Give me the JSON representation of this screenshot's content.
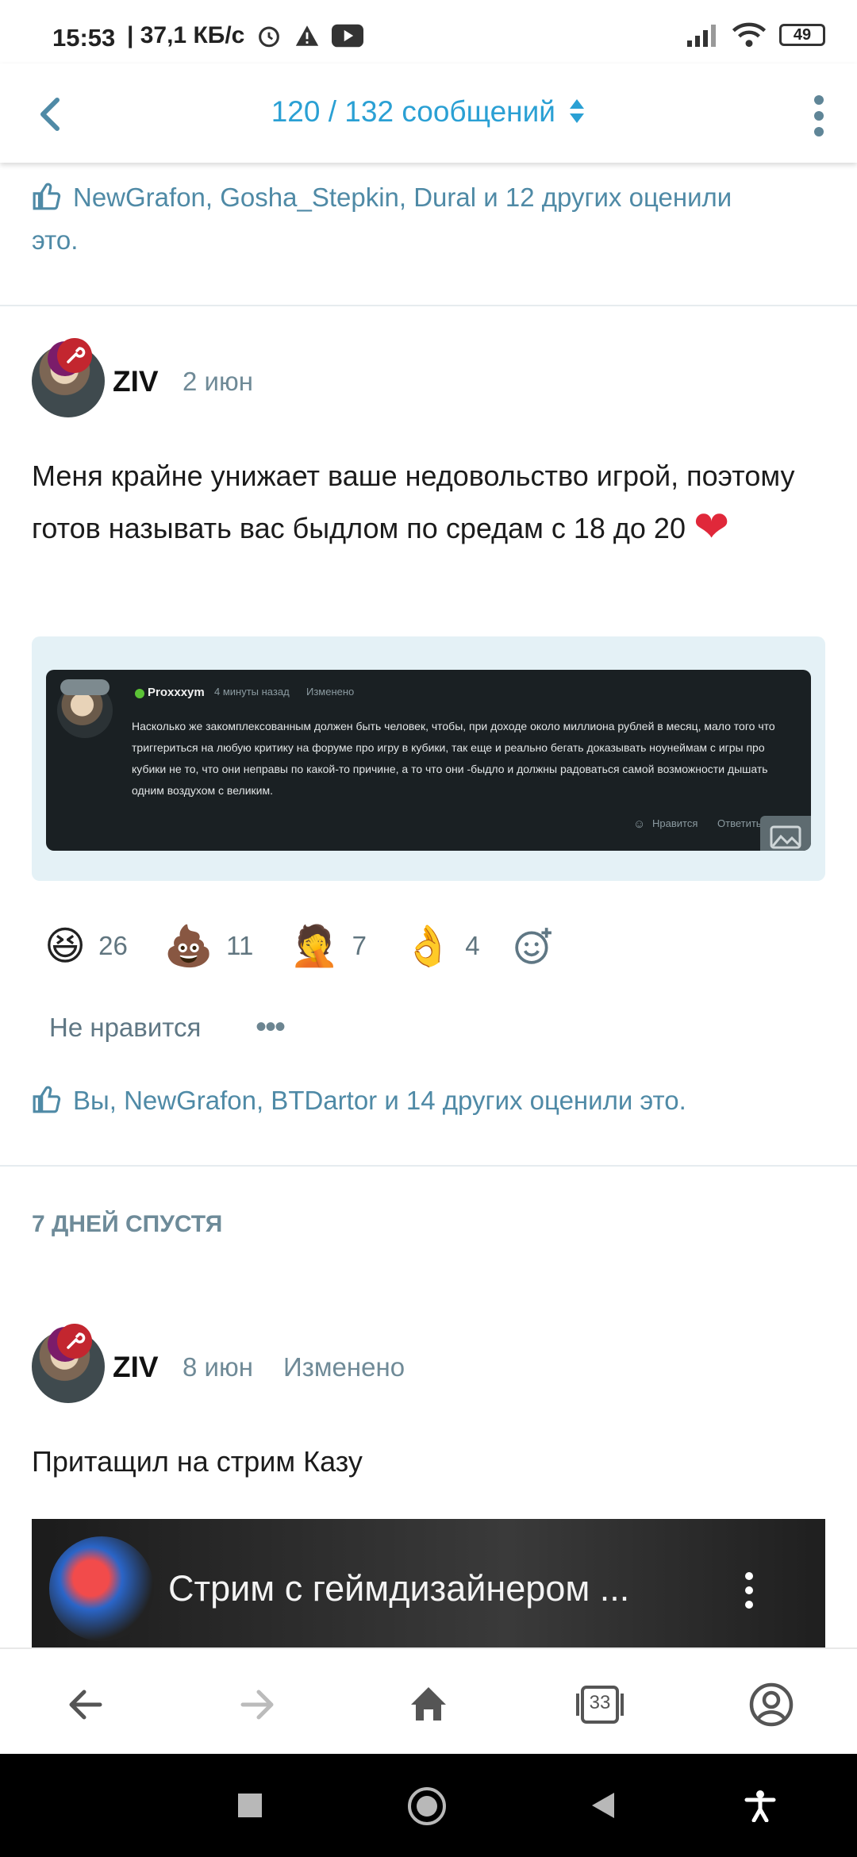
{
  "status_bar": {
    "time": "15:53",
    "net_speed": "| 37,1 КБ/с",
    "battery": "49",
    "icons": [
      "alarm-icon",
      "warning-icon",
      "youtube-icon",
      "signal-icon",
      "wifi-icon",
      "battery-icon"
    ]
  },
  "header": {
    "counter": "120 / 132 сообщений",
    "accent": "#2aa0d4"
  },
  "previous_post": {
    "likes": "NewGrafon, Gosha_Stepkin, Dural и 12 других оценили",
    "likes_tail": "это."
  },
  "post1": {
    "author": "ZIV",
    "date": "2 июн",
    "text": "Меня крайне унижает ваше недовольство игрой, поэтому готов называть вас быдлом по средам с 18 до 20",
    "text_emoji": "❤",
    "embed": {
      "name": "Proxxxym",
      "time": "4 минуты назад",
      "edited": "Изменено",
      "body": "Насколько же закомплексованным должен быть человек, чтобы, при доходе около миллиона рублей в месяц, мало того что триггериться на любую критику на форуме про игру в кубики, так еще и реально бегать доказывать ноунеймам с игры про кубики не то, что они неправы по какой-то причине, а то что они -быдло и должны радоваться самой возможности дышать одним воздухом с великим.",
      "like": "Нравится",
      "reply": "Ответить"
    },
    "reactions": [
      {
        "emoji": "😆",
        "count": "26"
      },
      {
        "emoji": "💩",
        "count": "11"
      },
      {
        "emoji": "🤦",
        "count": "7"
      },
      {
        "emoji": "👌",
        "count": "4"
      }
    ],
    "dislike": "Не нравится",
    "more": "•••",
    "likes": "Вы, NewGrafon, BTDartor и 14 других оценили это."
  },
  "time_gap": "7 ДНЕЙ СПУСТЯ",
  "post2": {
    "author": "ZIV",
    "date": "8 июн",
    "edited": "Изменено",
    "text": "Притащил на стрим Казу",
    "video_title": "Стрим с геймдизайнером ..."
  },
  "bottom_nav": {
    "tabs_count": "33"
  }
}
